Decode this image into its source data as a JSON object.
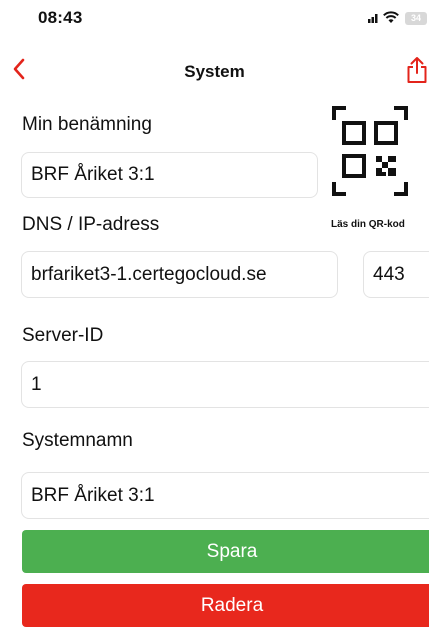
{
  "status_bar": {
    "time": "08:43",
    "battery": "34"
  },
  "nav": {
    "title": "System",
    "back_icon": "chevron-left-icon",
    "share_icon": "share-icon"
  },
  "form": {
    "name_label": "Min benämning",
    "name_value": "BRF Åriket 3:1",
    "dns_label": "DNS / IP-adress",
    "dns_value": "brfariket3-1.certegocloud.se",
    "port_value": "443",
    "server_id_label": "Server-ID",
    "server_id_value": "1",
    "system_name_label": "Systemnamn",
    "system_name_value": "BRF Åriket 3:1"
  },
  "qr": {
    "caption": "Läs din QR-kod",
    "icon": "qr-code-icon"
  },
  "buttons": {
    "save": "Spara",
    "delete": "Radera"
  },
  "colors": {
    "accent": "#e3241b",
    "save": "#4caf50",
    "delete": "#e8281d"
  }
}
